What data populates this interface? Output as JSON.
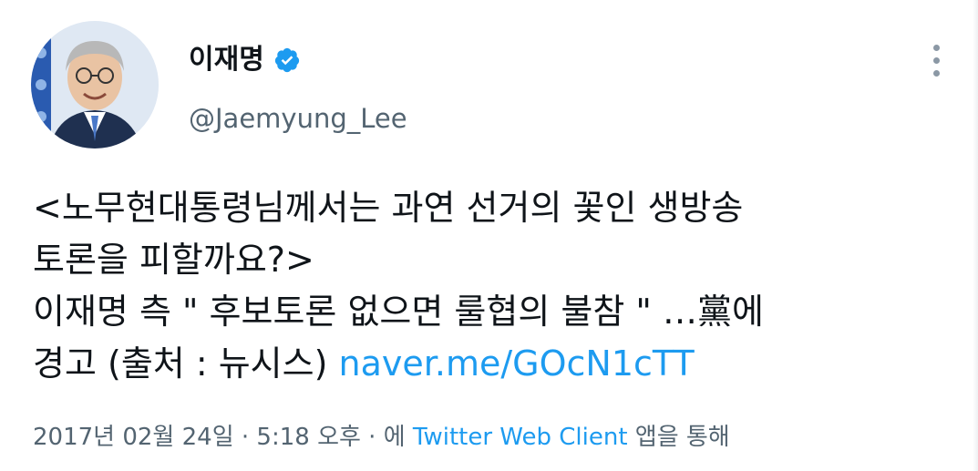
{
  "user": {
    "display_name": "이재명",
    "handle": "@Jaemyung_Lee",
    "verified_icon": "verified-badge-icon",
    "avatar_icon": "profile-photo"
  },
  "tweet": {
    "line1": "<노무현대통령님께서는 과연 선거의 꽃인 생방송",
    "line2": "토론을 피할까요?>",
    "line3": "이재명 측 \" 후보토론 없으면 룰협의 불참 \" …黨에",
    "line4_text": "경고 (출처 : 뉴시스) ",
    "link": "naver.me/GOcN1cTT"
  },
  "meta": {
    "timestamp": "2017년 02월 24일 · 5:18 오후 · 에 ",
    "client": "Twitter Web Client",
    "suffix": " 앱을 통해"
  },
  "colors": {
    "link": "#1d9bf0",
    "secondary_text": "#536471",
    "verified": "#1d9bf0"
  },
  "more_menu_icon": "more-vertical-icon"
}
